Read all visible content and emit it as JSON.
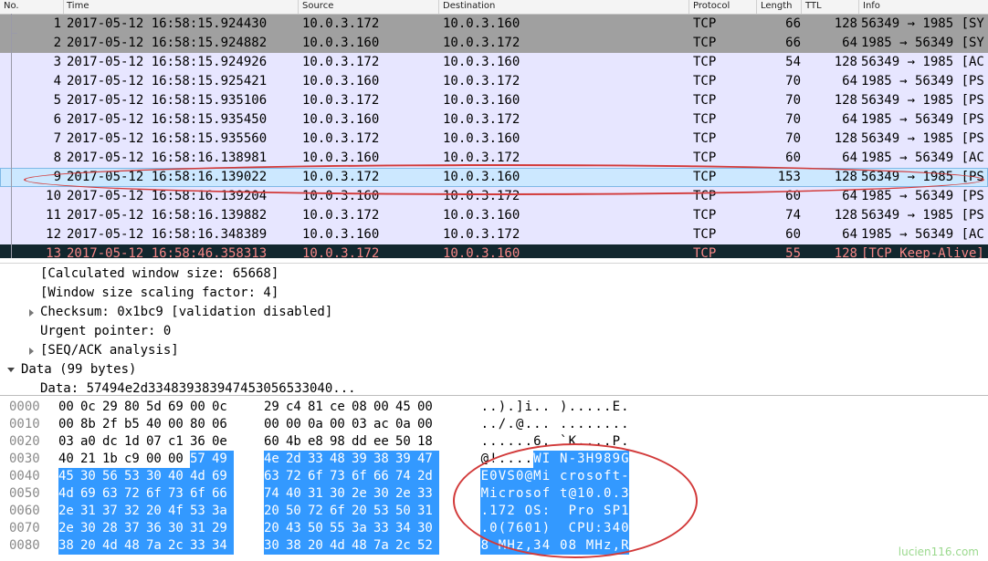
{
  "packet_list": {
    "columns": [
      "No.",
      "Time",
      "Source",
      "Destination",
      "Protocol",
      "Length",
      "TTL",
      "Info"
    ],
    "rows": [
      {
        "no": "1",
        "time": "2017-05-12 16:58:15.924430",
        "src": "10.0.3.172",
        "dst": "10.0.3.160",
        "proto": "TCP",
        "len": "66",
        "ttl": "128",
        "info": "56349 → 1985 [SY"
      },
      {
        "no": "2",
        "time": "2017-05-12 16:58:15.924882",
        "src": "10.0.3.160",
        "dst": "10.0.3.172",
        "proto": "TCP",
        "len": "66",
        "ttl": "64",
        "info": "1985 → 56349 [SY"
      },
      {
        "no": "3",
        "time": "2017-05-12 16:58:15.924926",
        "src": "10.0.3.172",
        "dst": "10.0.3.160",
        "proto": "TCP",
        "len": "54",
        "ttl": "128",
        "info": "56349 → 1985 [AC"
      },
      {
        "no": "4",
        "time": "2017-05-12 16:58:15.925421",
        "src": "10.0.3.160",
        "dst": "10.0.3.172",
        "proto": "TCP",
        "len": "70",
        "ttl": "64",
        "info": "1985 → 56349 [PS"
      },
      {
        "no": "5",
        "time": "2017-05-12 16:58:15.935106",
        "src": "10.0.3.172",
        "dst": "10.0.3.160",
        "proto": "TCP",
        "len": "70",
        "ttl": "128",
        "info": "56349 → 1985 [PS"
      },
      {
        "no": "6",
        "time": "2017-05-12 16:58:15.935450",
        "src": "10.0.3.160",
        "dst": "10.0.3.172",
        "proto": "TCP",
        "len": "70",
        "ttl": "64",
        "info": "1985 → 56349 [PS"
      },
      {
        "no": "7",
        "time": "2017-05-12 16:58:15.935560",
        "src": "10.0.3.172",
        "dst": "10.0.3.160",
        "proto": "TCP",
        "len": "70",
        "ttl": "128",
        "info": "56349 → 1985 [PS"
      },
      {
        "no": "8",
        "time": "2017-05-12 16:58:16.138981",
        "src": "10.0.3.160",
        "dst": "10.0.3.172",
        "proto": "TCP",
        "len": "60",
        "ttl": "64",
        "info": "1985 → 56349 [AC"
      },
      {
        "no": "9",
        "time": "2017-05-12 16:58:16.139022",
        "src": "10.0.3.172",
        "dst": "10.0.3.160",
        "proto": "TCP",
        "len": "153",
        "ttl": "128",
        "info": "56349 → 1985 [PS"
      },
      {
        "no": "10",
        "time": "2017-05-12 16:58:16.139204",
        "src": "10.0.3.160",
        "dst": "10.0.3.172",
        "proto": "TCP",
        "len": "60",
        "ttl": "64",
        "info": "1985 → 56349 [PS"
      },
      {
        "no": "11",
        "time": "2017-05-12 16:58:16.139882",
        "src": "10.0.3.172",
        "dst": "10.0.3.160",
        "proto": "TCP",
        "len": "74",
        "ttl": "128",
        "info": "56349 → 1985 [PS"
      },
      {
        "no": "12",
        "time": "2017-05-12 16:58:16.348389",
        "src": "10.0.3.160",
        "dst": "10.0.3.172",
        "proto": "TCP",
        "len": "60",
        "ttl": "64",
        "info": "1985 → 56349 [AC"
      },
      {
        "no": "13",
        "time": "2017-05-12 16:58:46.358313",
        "src": "10.0.3.172",
        "dst": "10.0.3.160",
        "proto": "TCP",
        "len": "55",
        "ttl": "128",
        "info": "[TCP Keep-Alive]"
      }
    ],
    "row_colors": {
      "syn": "#a0a0a0",
      "normal": "#e7e6ff",
      "selected": "#cce8ff",
      "keepalive_bg": "#12272e",
      "keepalive_fg": "#f78787"
    }
  },
  "details": {
    "lines": [
      {
        "text": "[Calculated window size: 65668]",
        "expander": "none",
        "indent": 2
      },
      {
        "text": "[Window size scaling factor: 4]",
        "expander": "none",
        "indent": 2
      },
      {
        "text": "Checksum: 0x1bc9 [validation disabled]",
        "expander": "collapsed",
        "indent": 2
      },
      {
        "text": "Urgent pointer: 0",
        "expander": "none",
        "indent": 2
      },
      {
        "text": "[SEQ/ACK analysis]",
        "expander": "collapsed",
        "indent": 2
      },
      {
        "text": "Data (99 bytes)",
        "expander": "expanded",
        "indent": 1
      },
      {
        "text": "Data: 57494e2d334839383947453056533040...",
        "expander": "none",
        "indent": 2
      }
    ]
  },
  "bytes": {
    "rows": [
      {
        "offset": "0000",
        "hex": [
          "00",
          "0c",
          "29",
          "80",
          "5d",
          "69",
          "00",
          "0c",
          "29",
          "c4",
          "81",
          "ce",
          "08",
          "00",
          "45",
          "00"
        ],
        "ascii": "..).]i.. ).....E."
      },
      {
        "offset": "0010",
        "hex": [
          "00",
          "8b",
          "2f",
          "b5",
          "40",
          "00",
          "80",
          "06",
          "00",
          "00",
          "0a",
          "00",
          "03",
          "ac",
          "0a",
          "00"
        ],
        "ascii": "../.@... ........"
      },
      {
        "offset": "0020",
        "hex": [
          "03",
          "a0",
          "dc",
          "1d",
          "07",
          "c1",
          "36",
          "0e",
          "60",
          "4b",
          "e8",
          "98",
          "dd",
          "ee",
          "50",
          "18"
        ],
        "ascii": "......6. `K....P."
      },
      {
        "offset": "0030",
        "hex": [
          "40",
          "21",
          "1b",
          "c9",
          "00",
          "00",
          "57",
          "49",
          "4e",
          "2d",
          "33",
          "48",
          "39",
          "38",
          "39",
          "47"
        ],
        "ascii": "@!....WI N-3H989G"
      },
      {
        "offset": "0040",
        "hex": [
          "45",
          "30",
          "56",
          "53",
          "30",
          "40",
          "4d",
          "69",
          "63",
          "72",
          "6f",
          "73",
          "6f",
          "66",
          "74",
          "2d"
        ],
        "ascii": "E0VS0@Mi crosoft-"
      },
      {
        "offset": "0050",
        "hex": [
          "4d",
          "69",
          "63",
          "72",
          "6f",
          "73",
          "6f",
          "66",
          "74",
          "40",
          "31",
          "30",
          "2e",
          "30",
          "2e",
          "33"
        ],
        "ascii": "Microsof t@10.0.3"
      },
      {
        "offset": "0060",
        "hex": [
          "2e",
          "31",
          "37",
          "32",
          "20",
          "4f",
          "53",
          "3a",
          "20",
          "50",
          "72",
          "6f",
          "20",
          "53",
          "50",
          "31"
        ],
        "ascii": ".172 OS:  Pro SP1"
      },
      {
        "offset": "0070",
        "hex": [
          "2e",
          "30",
          "28",
          "37",
          "36",
          "30",
          "31",
          "29",
          "20",
          "43",
          "50",
          "55",
          "3a",
          "33",
          "34",
          "30"
        ],
        "ascii": ".0(7601)  CPU:340"
      },
      {
        "offset": "0080",
        "hex": [
          "38",
          "20",
          "4d",
          "48",
          "7a",
          "2c",
          "33",
          "34",
          "30",
          "38",
          "20",
          "4d",
          "48",
          "7a",
          "2c",
          "52"
        ],
        "ascii": "8 MHz,34 08 MHz,R"
      }
    ],
    "highlight_color": "#3399ff"
  },
  "watermark": "lucien116.com"
}
